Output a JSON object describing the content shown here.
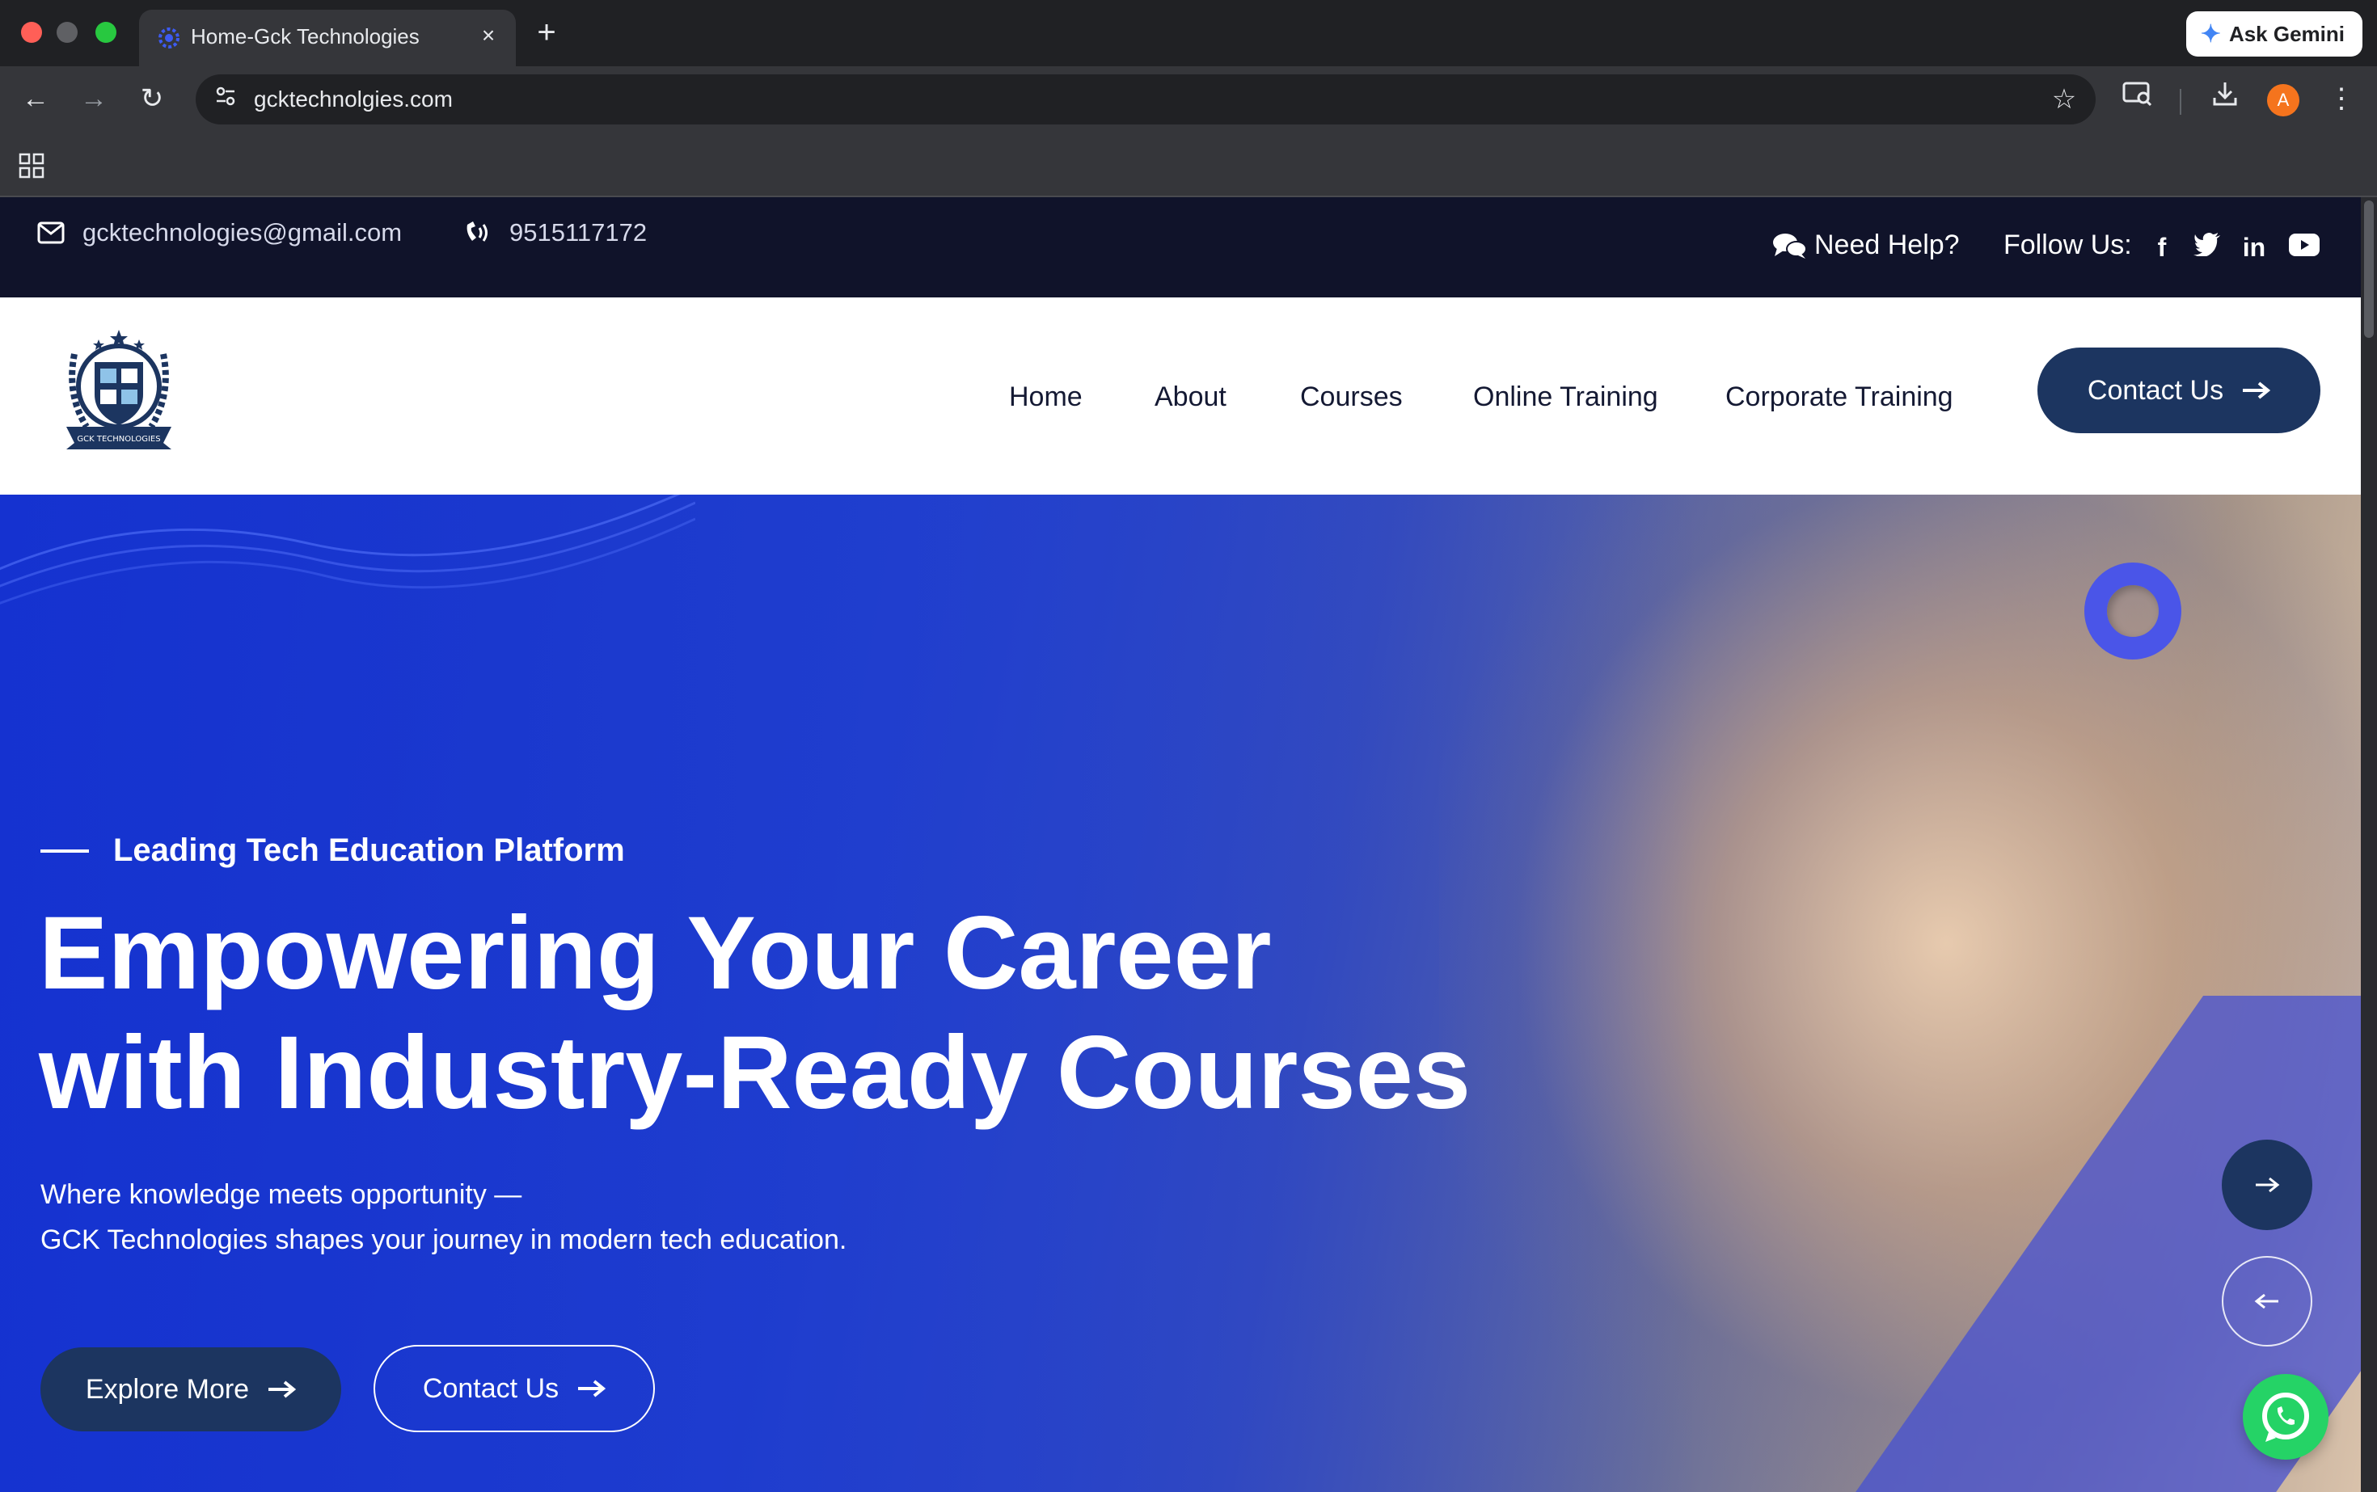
{
  "browser": {
    "tab_title": "Home-Gck Technologies",
    "new_tab": "+",
    "close_tab": "×",
    "ask_gemini": "Ask Gemini",
    "url": "gcktechnolgies.com",
    "profile_initial": "A"
  },
  "topbar": {
    "email": "gcktechnologies@gmail.com",
    "phone": "9515117172",
    "need_help": "Need Help?",
    "follow_us": "Follow Us:",
    "social_icons": [
      "facebook-icon",
      "twitter-icon",
      "linkedin-icon",
      "youtube-icon"
    ]
  },
  "nav": {
    "items": [
      "Home",
      "About",
      "Courses",
      "Online Training",
      "Corporate Training"
    ],
    "cta": "Contact Us"
  },
  "logo": {
    "text": "GCK TECHNOLOGIES"
  },
  "hero": {
    "tagline": "Leading Tech Education Platform",
    "headline_line1": "Empowering Your Career",
    "headline_line2": "with Industry-Ready Courses",
    "sub_line1": "Where knowledge meets opportunity —",
    "sub_line2": "GCK Technologies shapes your journey in modern tech education.",
    "explore_button": "Explore More",
    "contact_button": "Contact Us"
  },
  "colors": {
    "navy": "#1c3560",
    "topbar": "#10132a",
    "hero_blue": "#2443c9",
    "whatsapp": "#25d366"
  }
}
